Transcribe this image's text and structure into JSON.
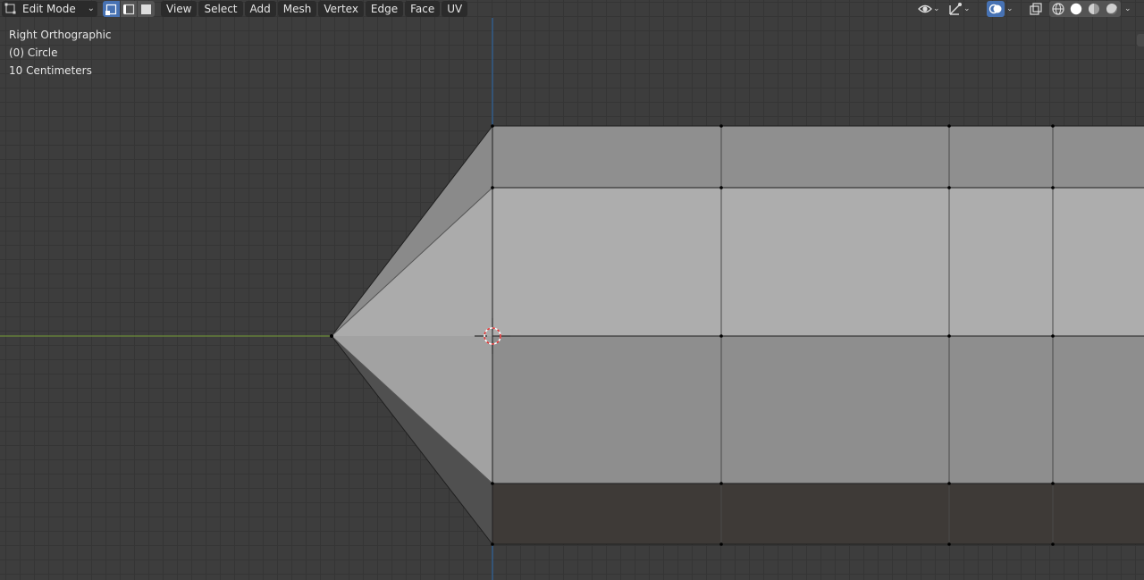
{
  "header": {
    "mode_label": "Edit Mode",
    "select_modes": [
      "vertex-select",
      "edge-select",
      "face-select"
    ],
    "active_select_mode": "vertex-select",
    "menu": [
      "View",
      "Select",
      "Add",
      "Mesh",
      "Vertex",
      "Edge",
      "Face",
      "UV"
    ]
  },
  "viewport_info": {
    "view": "Right Orthographic",
    "object": "(0) Circle",
    "scale": "10 Centimeters"
  },
  "colors": {
    "viewport_bg": "#3d3d3d",
    "grid": "#353535",
    "axis_y": "#6b8b3a",
    "axis_z": "#2f6fb3",
    "active_button": "#4772b3",
    "menu_bg": "#2b2b2b",
    "cursor_red": "#e23636"
  },
  "icons": [
    "mode-icon",
    "visibility-icon",
    "gizmo-icon",
    "overlay-icon",
    "xray-icon",
    "wireframe-shading-icon",
    "solid-shading-icon",
    "material-shading-icon",
    "rendered-shading-icon"
  ]
}
